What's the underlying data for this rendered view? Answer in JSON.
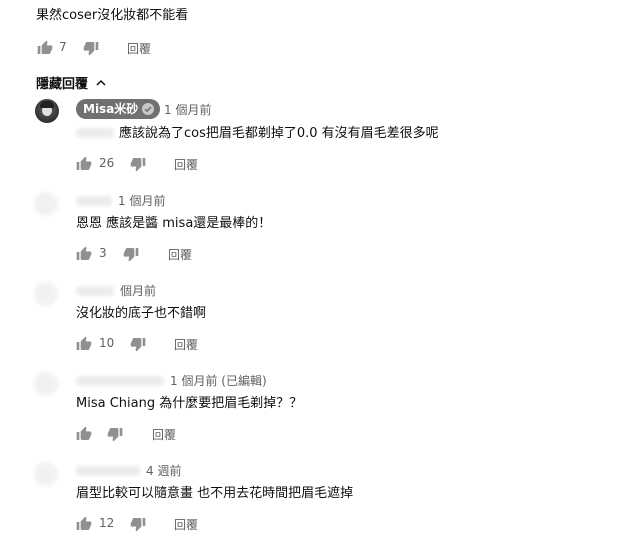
{
  "top_comment": {
    "text": "果然coser沒化妝都不能看",
    "likes": "7",
    "reply_label": "回覆"
  },
  "hide_replies": {
    "label": "隱藏回覆"
  },
  "replies": [
    {
      "author": "Misa米砂",
      "time": "1 個月前",
      "mention": "",
      "text": "應該說為了cos把眉毛都剃掉了0.0 有沒有眉毛差很多呢",
      "likes": "26",
      "reply_label": "回覆"
    },
    {
      "author": "",
      "time": "1 個月前",
      "text": "恩恩 應該是醬 misa還是最棒的！",
      "likes": "3",
      "reply_label": "回覆"
    },
    {
      "author": "",
      "time": "個月前",
      "text": "沒化妝的底子也不錯啊",
      "likes": "10",
      "reply_label": "回覆"
    },
    {
      "author": "",
      "time": "1 個月前 (已編輯)",
      "text": "Misa Chiang 為什麼要把眉毛剃掉？？",
      "likes": "",
      "reply_label": "回覆"
    },
    {
      "author": "",
      "time": "4 週前",
      "text": "眉型比較可以隨意畫 也不用去花時間把眉毛遮掉",
      "likes": "12",
      "reply_label": "回覆"
    }
  ],
  "icons": {
    "like": "thumb-up-icon",
    "dislike": "thumb-down-icon",
    "verified": "check-icon",
    "chevron": "chevron-up-icon"
  },
  "colors": {
    "text": "#0f0f0f",
    "meta": "#606060",
    "icon": "#909090",
    "badge": "#707070"
  }
}
